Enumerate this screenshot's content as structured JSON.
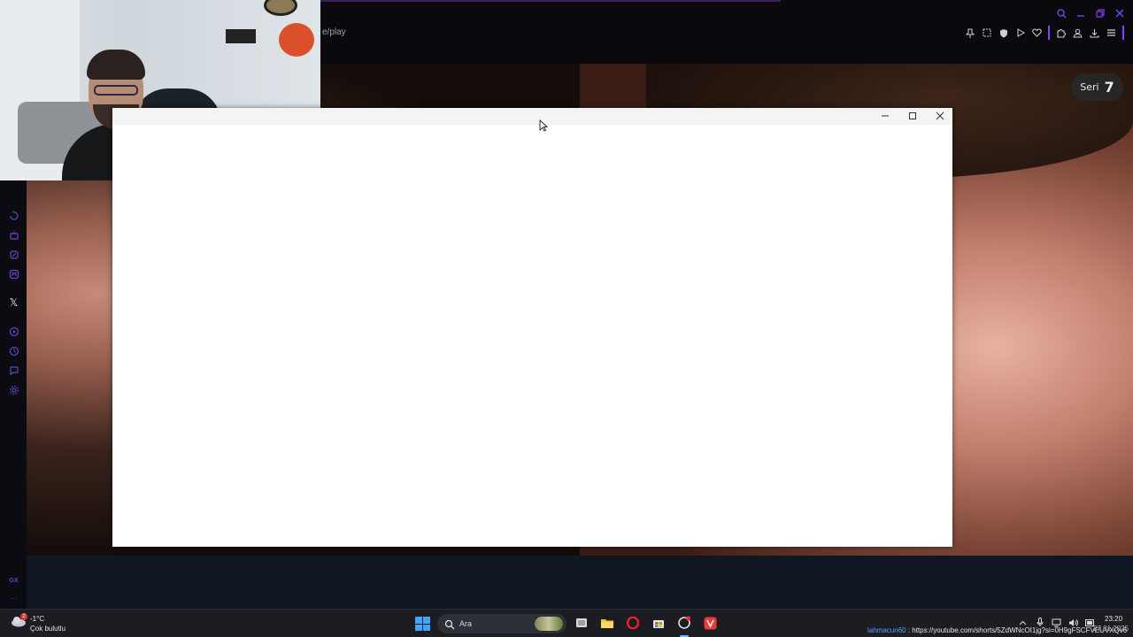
{
  "browser": {
    "url_fragment": "e/play",
    "accent_color": "#8b3dff",
    "window_controls": [
      "search-icon",
      "minimize-icon",
      "restore-icon",
      "close-icon"
    ],
    "toolbar_icons": [
      "pin-icon",
      "snapshot-icon",
      "shield-icon",
      "play-icon",
      "heart-icon",
      "extensions-icon",
      "account-icon",
      "download-icon",
      "menu-icon"
    ]
  },
  "sidebar": {
    "items": [
      "history-icon",
      "robot-icon",
      "sparkle-icon",
      "m-app-icon",
      "x-icon",
      "player-icon",
      "clock-icon",
      "chat-icon",
      "settings-icon",
      "gx-icon",
      "more-icon"
    ],
    "x_label": "𝕏",
    "gx_label": "GX",
    "more_label": "···"
  },
  "page": {
    "seri_label": "Seri",
    "seri_value": "7"
  },
  "popup": {
    "controls": [
      "minimize-icon",
      "maximize-icon",
      "close-icon"
    ],
    "title": ""
  },
  "taskbar": {
    "weather": {
      "temp": "-1°C",
      "desc": "Çok bulutlu",
      "badge": "2"
    },
    "search_placeholder": "Ara",
    "apps": [
      "start-icon",
      "search-icon",
      "task-view-icon",
      "file-explorer-icon",
      "opera-icon",
      "store-icon",
      "opera-gx-icon",
      "vivaldi-icon"
    ],
    "chat_user": "lahmacun60",
    "chat_link": " : https://youtube.com/shorts/5ZdWNcOI1jg?si=0H9gFSCFVEUVXQv6",
    "time": "23:20",
    "date": "27.01.2025"
  }
}
